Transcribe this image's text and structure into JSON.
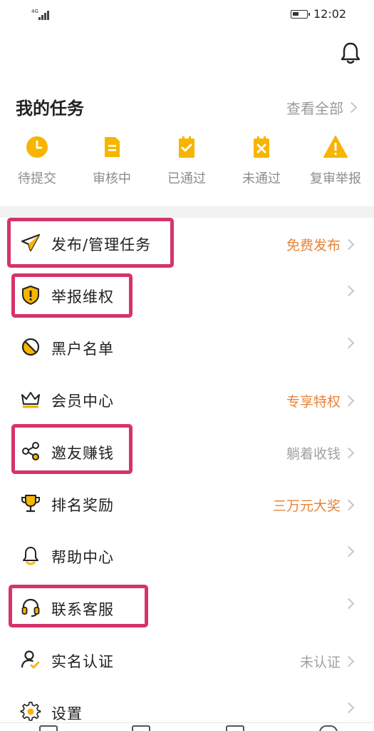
{
  "status_bar": {
    "network": "4G",
    "time": "12:02"
  },
  "header": {
    "bell_icon": "bell-icon"
  },
  "my_tasks": {
    "title": "我的任务",
    "view_all": "查看全部",
    "statuses": [
      {
        "label": "待提交",
        "icon": "clock-icon"
      },
      {
        "label": "审核中",
        "icon": "document-icon"
      },
      {
        "label": "已通过",
        "icon": "clipboard-check-icon"
      },
      {
        "label": "未通过",
        "icon": "clipboard-x-icon"
      },
      {
        "label": "复审举报",
        "icon": "warning-icon"
      }
    ]
  },
  "menu": {
    "items": [
      {
        "label": "发布/管理任务",
        "icon": "paper-plane-icon",
        "right": "免费发布",
        "right_style": "orange"
      },
      {
        "label": "举报维权",
        "icon": "shield-alert-icon",
        "right": "",
        "right_style": "grey"
      },
      {
        "label": "黑户名单",
        "icon": "ban-icon",
        "right": "",
        "right_style": "grey"
      },
      {
        "label": "会员中心",
        "icon": "crown-icon",
        "right": "专享特权",
        "right_style": "orange"
      },
      {
        "label": "邀友赚钱",
        "icon": "share-icon",
        "right": "躺着收钱",
        "right_style": "grey"
      },
      {
        "label": "排名奖励",
        "icon": "trophy-icon",
        "right": "三万元大奖",
        "right_style": "orange"
      },
      {
        "label": "帮助中心",
        "icon": "help-bell-icon",
        "right": "",
        "right_style": "grey"
      },
      {
        "label": "联系客服",
        "icon": "headset-icon",
        "right": "",
        "right_style": "grey"
      },
      {
        "label": "实名认证",
        "icon": "user-check-icon",
        "right": "未认证",
        "right_style": "grey"
      },
      {
        "label": "设置",
        "icon": "gear-icon",
        "right": "",
        "right_style": "grey"
      }
    ]
  },
  "colors": {
    "accent_yellow": "#f7b500",
    "accent_orange": "#e8833a",
    "highlight_pink": "#d6336c",
    "muted_text": "#9a9a9a"
  }
}
